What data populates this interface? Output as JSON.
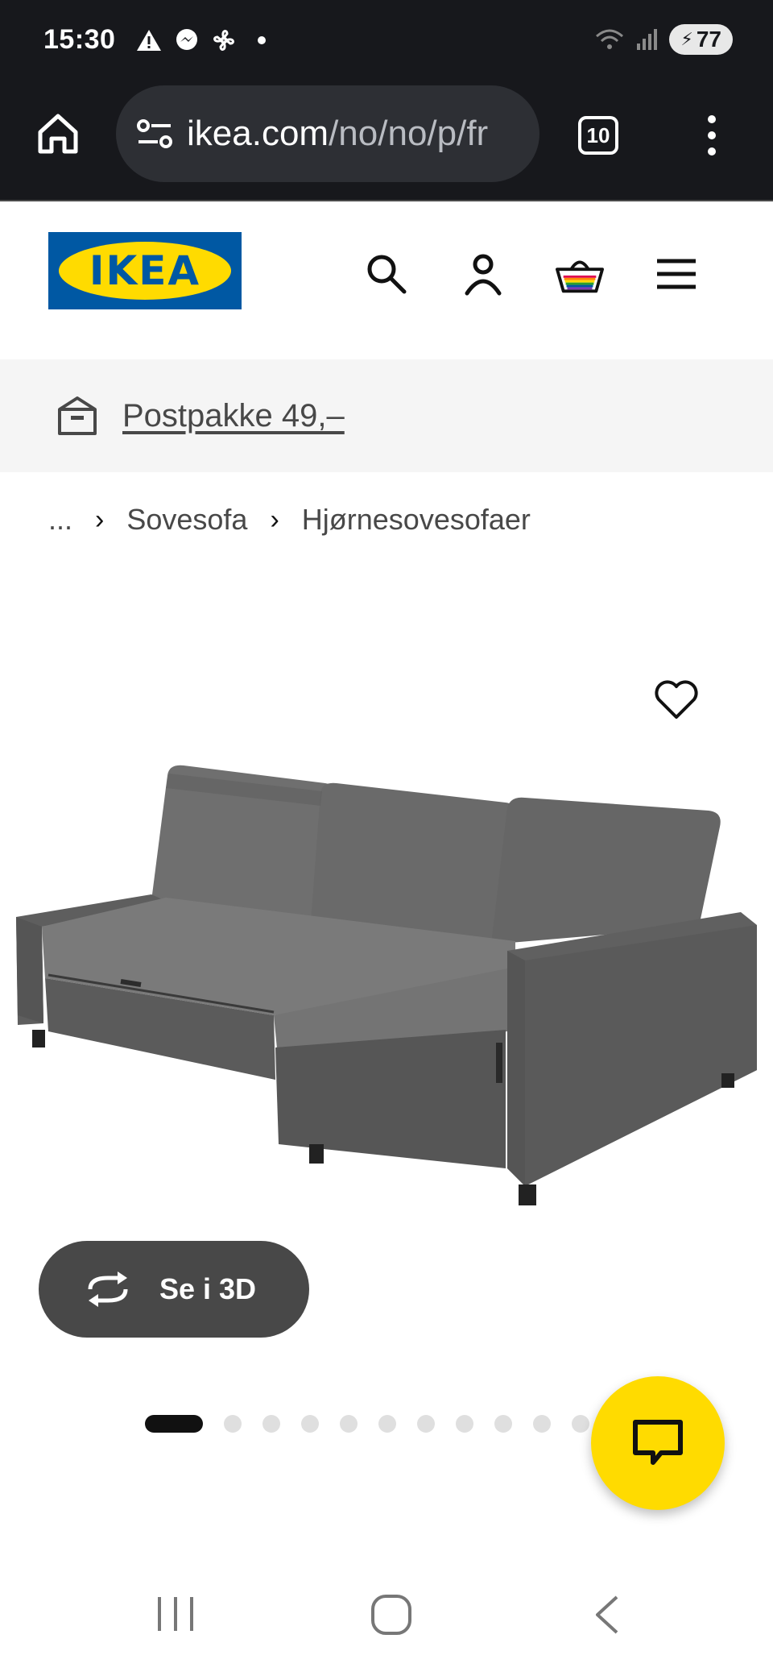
{
  "status_bar": {
    "time": "15:30",
    "battery": "77",
    "icons_left": [
      "warning-icon",
      "messenger-icon",
      "fan-icon",
      "dot-icon"
    ],
    "icons_right": [
      "wifi-icon",
      "signal-icon",
      "battery-icon"
    ]
  },
  "browser": {
    "url_host": "ikea.com",
    "url_path": "/no/no/p/fr",
    "tab_count": "10"
  },
  "header": {
    "logo_text": "IKEA",
    "icons": [
      "search-icon",
      "account-icon",
      "cart-icon",
      "menu-icon"
    ]
  },
  "promo": {
    "text": "Postpakke 49,–",
    "icon": "package-icon"
  },
  "breadcrumb": {
    "items": [
      "...",
      "Sovesofa",
      "Hjørnesovesofaer"
    ]
  },
  "product": {
    "see_3d_label": "Se i 3D",
    "carousel": {
      "total": 12,
      "active": 1
    }
  },
  "colors": {
    "ikea_blue": "#0058a3",
    "ikea_yellow": "#ffdb00",
    "dark_bar": "#17181c",
    "button_gray": "#484848"
  }
}
